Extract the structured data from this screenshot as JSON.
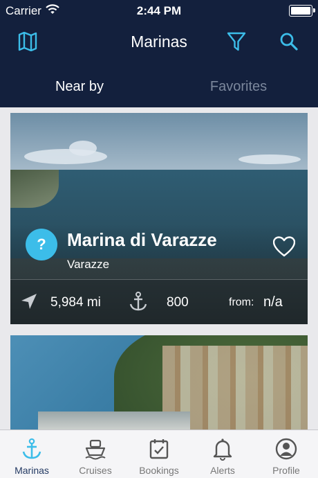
{
  "status": {
    "carrier": "Carrier",
    "time": "2:44 PM",
    "battery_level": 1.0
  },
  "nav": {
    "title": "Marinas",
    "left_icon": "map-icon",
    "filter_icon": "filter-icon",
    "search_icon": "search-icon"
  },
  "segments": {
    "active": "Near by",
    "inactive": "Favorites"
  },
  "marinas": [
    {
      "badge": "?",
      "name": "Marina di Varazze",
      "town": "Varazze",
      "distance": "5,984 mi",
      "berths": "800",
      "price_label": "from:",
      "price_value": "n/a"
    }
  ],
  "tabs": [
    {
      "label": "Marinas",
      "icon": "anchor-icon",
      "active": true
    },
    {
      "label": "Cruises",
      "icon": "ship-icon",
      "active": false
    },
    {
      "label": "Bookings",
      "icon": "calendar-icon",
      "active": false
    },
    {
      "label": "Alerts",
      "icon": "bell-icon",
      "active": false
    },
    {
      "label": "Profile",
      "icon": "profile-icon",
      "active": false
    }
  ],
  "colors": {
    "header": "#13203d",
    "accent": "#3cbde9",
    "tab_active": "#243a63"
  }
}
